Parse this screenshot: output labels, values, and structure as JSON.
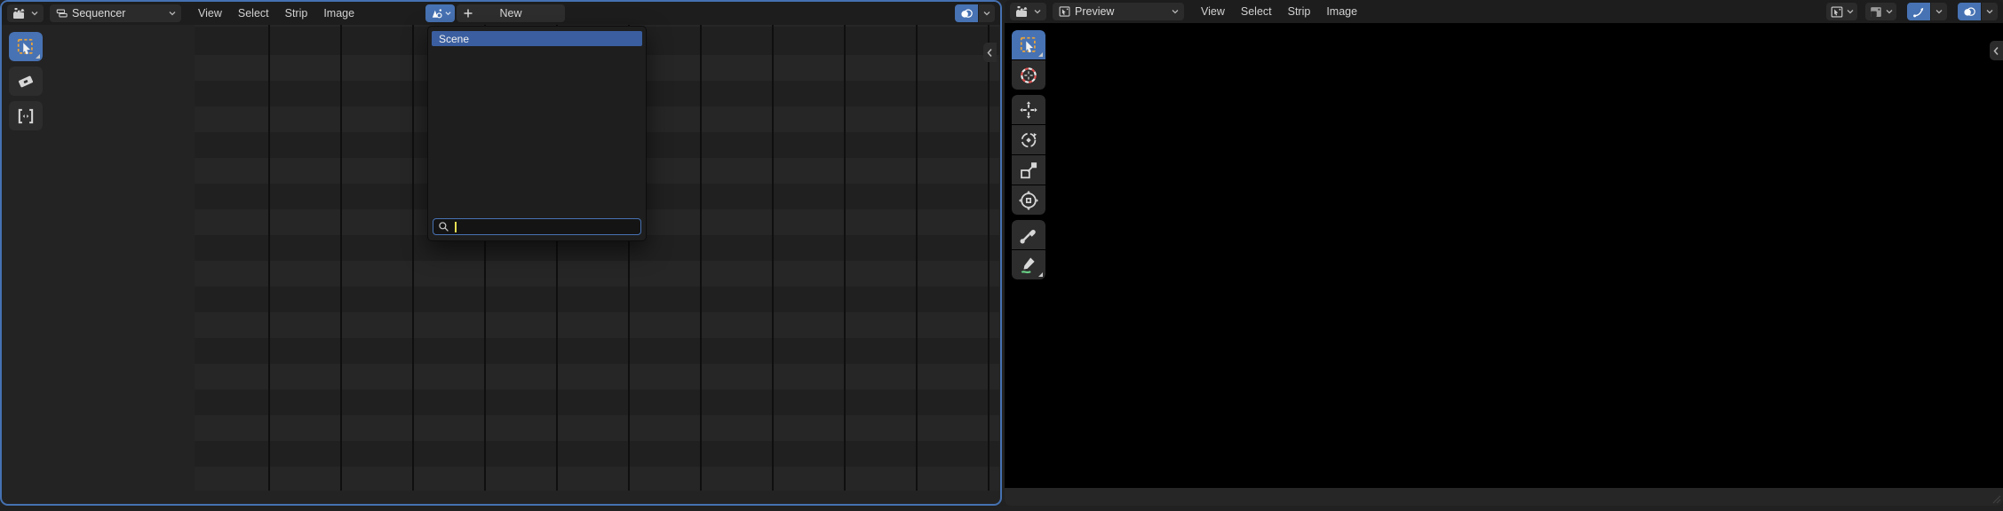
{
  "left_editor": {
    "editor_type": "Video Sequencer",
    "mode_select": "Sequencer",
    "menus": [
      "View",
      "Select",
      "Strip",
      "Image"
    ],
    "datablock": {
      "new_button": "New"
    },
    "popup": {
      "items": [
        {
          "label": "Scene",
          "selected": true
        }
      ],
      "search_value": ""
    },
    "tools": [
      "select-box",
      "blade",
      "slip"
    ],
    "active_tool": "select-box"
  },
  "right_editor": {
    "editor_type": "Video Sequencer",
    "mode_select": "Preview",
    "menus": [
      "View",
      "Select",
      "Strip",
      "Image"
    ],
    "tools": [
      "select-box",
      "cursor",
      "move",
      "rotate",
      "scale",
      "transform",
      "sample",
      "annotate"
    ],
    "active_tool": "select-box"
  },
  "icons": {
    "clapperboard": "editor type chooser",
    "sequencer-strips": "sequencer mode",
    "preview-image": "preview mode",
    "chevron-down": "˅",
    "scene": "cone and sphere",
    "plus": "+",
    "overlays": "two overlapping circles",
    "gizmo": "curved arrow",
    "search": "magnifier",
    "collapse-arrow": "‹"
  },
  "colors": {
    "accent": "#4772b3",
    "popup_selected": "#3a5e9f",
    "header_bg": "#1d1d1d",
    "timeline_bg": "#232323",
    "preview_bg": "#000000",
    "search_caret": "#e6df52",
    "tool_dash_orange": "#e8a33c",
    "annotate_green": "#6bd488",
    "cursor_tool_red": "#e05252"
  }
}
